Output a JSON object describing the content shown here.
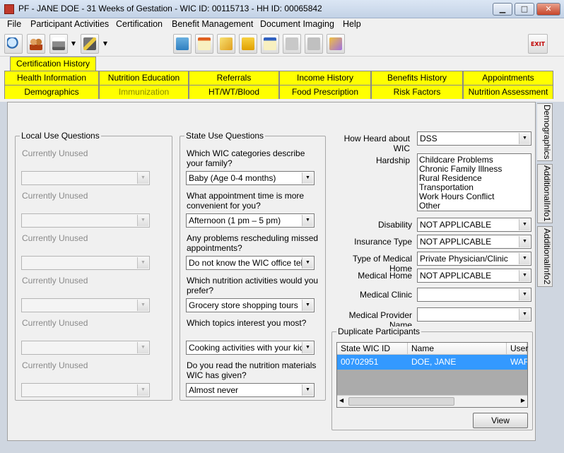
{
  "window": {
    "title": "PF - JANE DOE - 31 Weeks of Gestation - WIC ID: 00115713 - HH ID: 00065842",
    "minimize": "▁",
    "maximize": "□",
    "close": "✕"
  },
  "menu": {
    "items": [
      "File",
      "Participant Activities",
      "Certification",
      "Benefit Management",
      "Document Imaging",
      "Help"
    ]
  },
  "toolbar": {
    "icons": [
      "search-icon",
      "family-icon",
      "printer-icon",
      "tools-icon",
      "scan-icon",
      "calendar-icon",
      "warning-icon",
      "note-icon",
      "form-icon",
      "chat-icon",
      "transfer-icon",
      "folder-icon"
    ],
    "exit_label": "EXIT"
  },
  "tabs": {
    "row1": [
      "Certification History"
    ],
    "row2": [
      "Health Information",
      "Nutrition Education",
      "Referrals",
      "Income History",
      "Benefits History",
      "Appointments"
    ],
    "row3": [
      "Demographics",
      "Immunization",
      "HT/WT/Blood",
      "Food Prescription",
      "Risk Factors",
      "Nutrition Assessment"
    ]
  },
  "side_tabs": [
    "Demographics",
    "AdditionalInfo1",
    "AdditionalInfo2"
  ],
  "local": {
    "title": "Local Use Questions",
    "items": [
      "Currently Unused",
      "Currently Unused",
      "Currently Unused",
      "Currently Unused",
      "Currently Unused",
      "Currently Unused"
    ]
  },
  "state": {
    "title": "State Use Questions",
    "questions": [
      {
        "q": "Which WIC categories describe your family?",
        "a": "Baby (Age 0-4 months)"
      },
      {
        "q": "What appointment time is more convenient for you?",
        "a": "Afternoon (1 pm – 5 pm)"
      },
      {
        "q": "Any problems rescheduling missed appointments?",
        "a": "Do not know the WIC office teleph"
      },
      {
        "q": "Which nutrition activities would you prefer?",
        "a": "Grocery store shopping tours"
      },
      {
        "q": "Which topics interest you most?",
        "a": "Cooking activities with your kids"
      },
      {
        "q": "Do you read the nutrition materials WIC has given?",
        "a": "Almost never"
      }
    ]
  },
  "right": {
    "how_heard_label": "How Heard about WIC",
    "how_heard": "DSS",
    "hardship_label": "Hardship",
    "hardship_items": [
      "Childcare Problems",
      "Chronic Family Illness",
      "Rural Residence",
      "Transportation",
      "Work Hours Conflict",
      "Other"
    ],
    "disability_label": "Disability",
    "disability": "NOT APPLICABLE",
    "insurance_label": "Insurance Type",
    "insurance": "NOT APPLICABLE",
    "medhome_type_label": "Type of Medical Home",
    "medhome_type": "Private Physician/Clinic",
    "medhome_label": "Medical Home",
    "medhome": "NOT APPLICABLE",
    "clinic_label": "Medical Clinic",
    "clinic": "",
    "provider_label": "Medical Provider Name",
    "provider": ""
  },
  "duplicates": {
    "title": "Duplicate Participants",
    "columns": [
      "State WIC ID",
      "Name",
      "User"
    ],
    "rows": [
      [
        "00702951",
        "DOE, JANE",
        "WAR"
      ]
    ],
    "view_label": "View"
  }
}
